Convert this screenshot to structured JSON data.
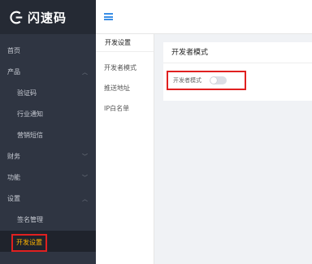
{
  "brand": {
    "name": "闪速码",
    "accent": "#3a8ee6",
    "sidebar_bg": "#2f3542"
  },
  "sidebar": {
    "items": [
      {
        "label": "首页",
        "type": "top"
      },
      {
        "label": "产品",
        "type": "group",
        "expanded": true
      },
      {
        "label": "验证码",
        "type": "sub"
      },
      {
        "label": "行业通知",
        "type": "sub"
      },
      {
        "label": "营销短信",
        "type": "sub"
      },
      {
        "label": "财务",
        "type": "group"
      },
      {
        "label": "功能",
        "type": "group"
      },
      {
        "label": "设置",
        "type": "group",
        "expanded": true
      },
      {
        "label": "签名管理",
        "type": "sub"
      },
      {
        "label": "开发设置",
        "type": "sub",
        "active": true
      }
    ]
  },
  "submenu": {
    "title": "开发设置",
    "items": [
      "开发者模式",
      "推送地址",
      "IP白名单"
    ]
  },
  "main": {
    "card_title": "开发者模式",
    "setting_label": "开发者模式",
    "toggle_on": false
  }
}
